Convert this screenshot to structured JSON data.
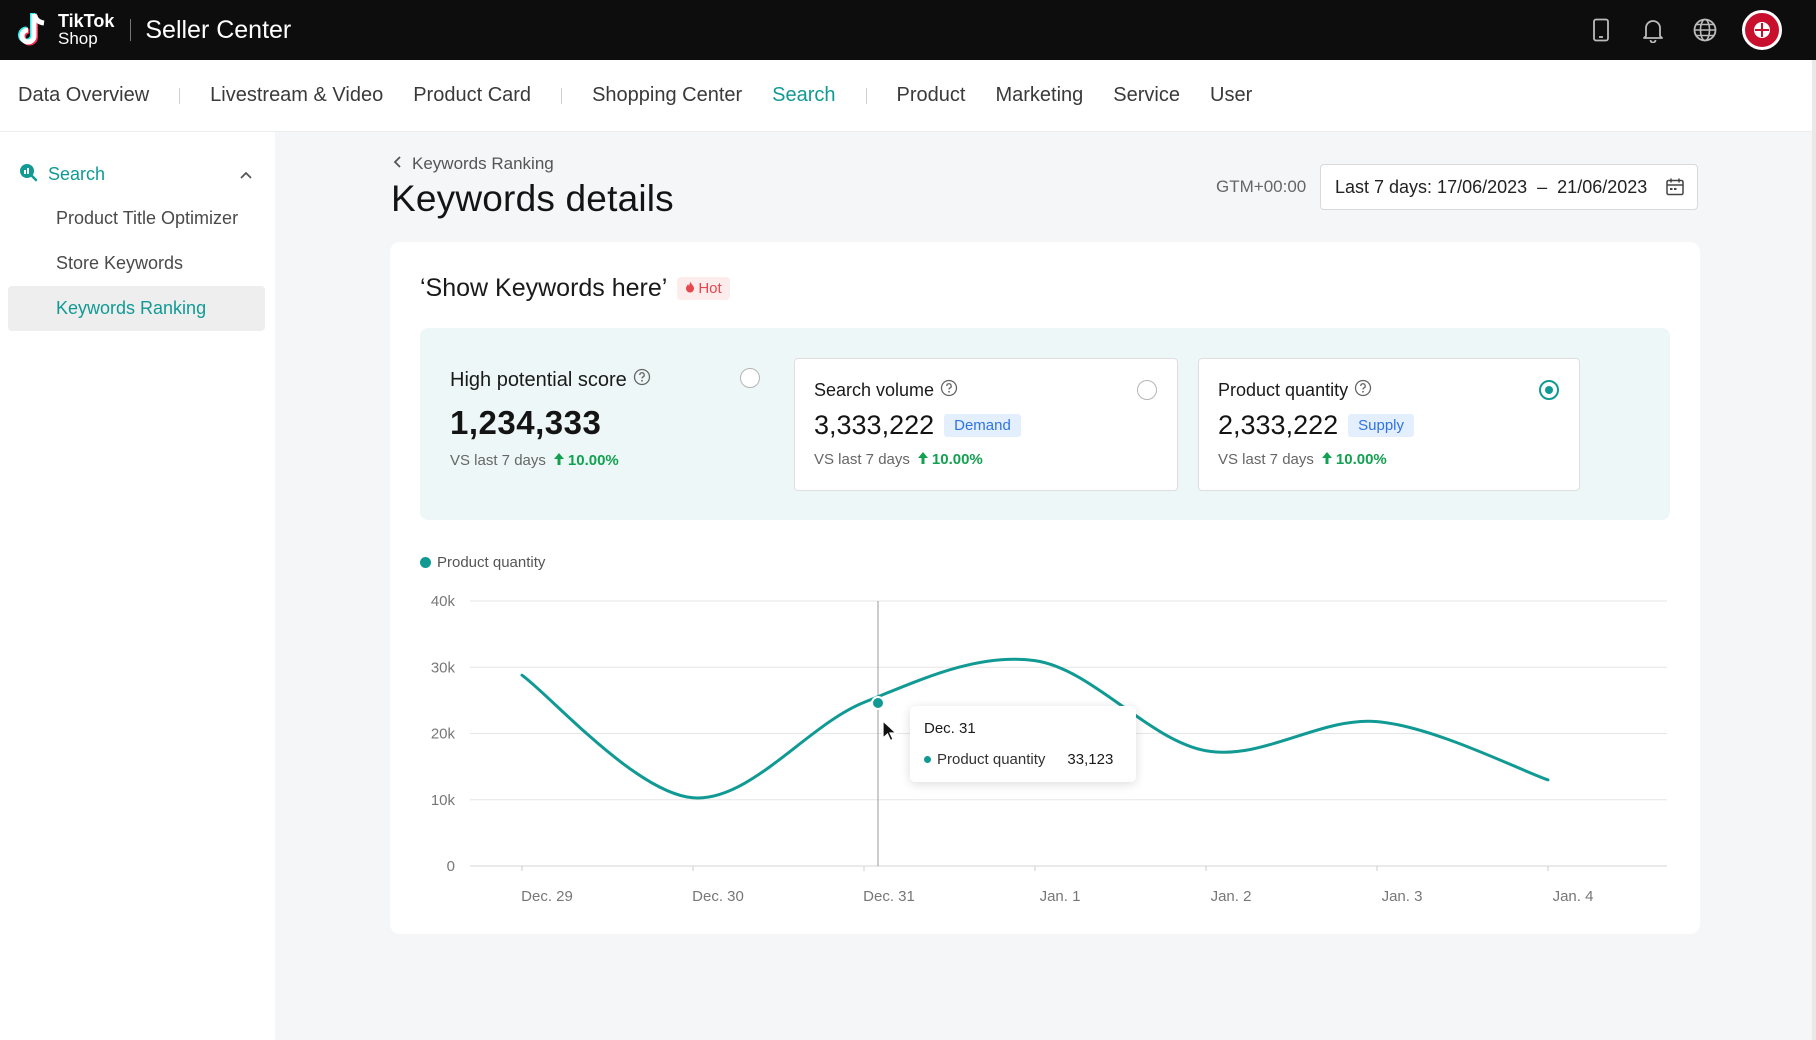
{
  "brand": {
    "logo_line1": "TikTok",
    "logo_line2": "Shop",
    "app_title": "Seller Center"
  },
  "header_icons": [
    "mobile-icon",
    "bell-icon",
    "globe-icon",
    "avatar"
  ],
  "nav": {
    "items": [
      "Data Overview",
      "Livestream & Video",
      "Product Card",
      "Shopping Center",
      "Search",
      "Product",
      "Marketing",
      "Service",
      "User"
    ],
    "active": "Search"
  },
  "sidebar": {
    "group_label": "Search",
    "items": [
      {
        "label": "Product Title Optimizer"
      },
      {
        "label": "Store Keywords"
      },
      {
        "label": "Keywords Ranking",
        "active": true
      }
    ]
  },
  "page": {
    "breadcrumb": "Keywords Ranking",
    "title": "Keywords details",
    "timezone": "GTM+00:00",
    "date_range": {
      "label": "Last 7 days: 17/06/2023",
      "separator": "–",
      "end": "21/06/2023"
    }
  },
  "keyword": {
    "title": "‘Show Keywords here’",
    "badge": "Hot"
  },
  "metrics": {
    "high_potential": {
      "label": "High potential score",
      "value": "1,234,333",
      "vs_label": "VS last 7 days",
      "change": "10.00%"
    },
    "search_volume": {
      "label": "Search volume",
      "value": "3,333,222",
      "tag": "Demand",
      "vs_label": "VS last 7 days",
      "change": "10.00%"
    },
    "product_quantity": {
      "label": "Product quantity",
      "value": "2,333,222",
      "tag": "Supply",
      "vs_label": "VS last 7 days",
      "change": "10.00%"
    }
  },
  "selected_metric": "product_quantity",
  "colors": {
    "accent": "#119a94",
    "up": "#12a150",
    "hot": "#e5484d",
    "tag_blue": "#2f74e0"
  },
  "chart_data": {
    "type": "line",
    "x": [
      "Dec. 29",
      "Dec. 30",
      "Dec. 31",
      "Jan. 1",
      "Jan. 2",
      "Jan. 3",
      "Jan. 4"
    ],
    "series": [
      {
        "name": "Product quantity",
        "values": [
          28800,
          10300,
          24700,
          31000,
          17400,
          21800,
          13000
        ]
      }
    ],
    "ylim": [
      0,
      40000
    ],
    "yticks": [
      "0",
      "10k",
      "20k",
      "30k",
      "40k"
    ],
    "grid": true,
    "legend": "top-left",
    "tooltip": {
      "date": "Dec. 31",
      "series": "Product quantity",
      "value": "33,123"
    }
  }
}
